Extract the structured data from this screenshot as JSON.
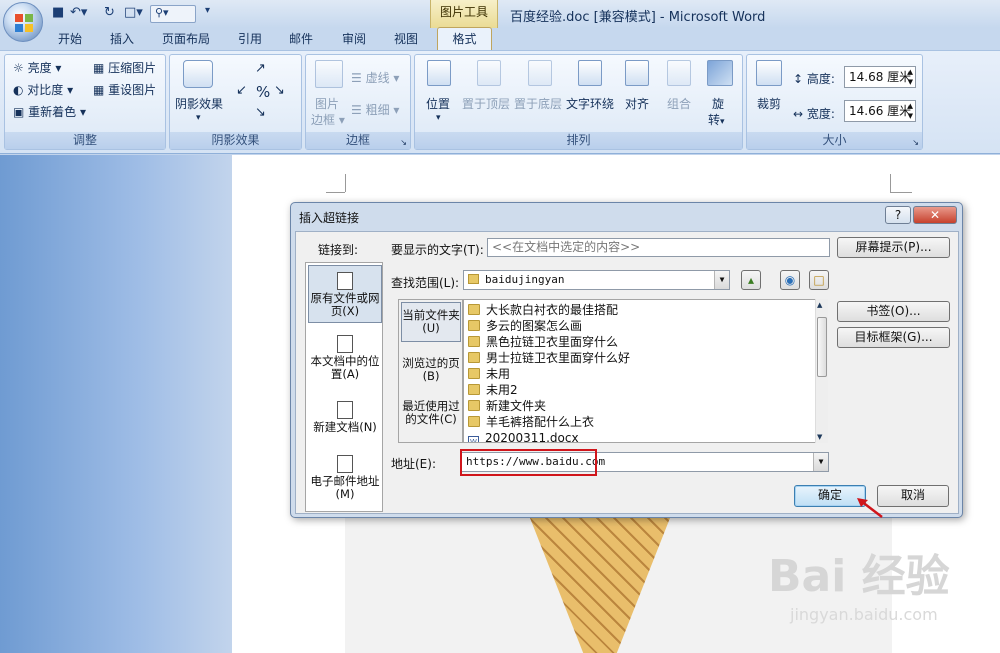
{
  "window": {
    "doc_title": "百度经验.doc [兼容模式] - Microsoft Word",
    "context_tab_group": "图片工具"
  },
  "tabs": [
    "开始",
    "插入",
    "页面布局",
    "引用",
    "邮件",
    "审阅",
    "视图",
    "格式"
  ],
  "active_tab": "格式",
  "ribbon": {
    "adjust": {
      "label": "调整",
      "brightness": "亮度",
      "contrast": "对比度",
      "recolor": "重新着色",
      "compress": "压缩图片",
      "reset": "重设图片"
    },
    "shadow": {
      "label": "阴影效果",
      "shadow_effects": "阴影效果"
    },
    "border": {
      "label": "边框",
      "picture_border_1": "图片",
      "picture_border_2": "边框",
      "dashes": "虚线",
      "weight": "粗细"
    },
    "arrange": {
      "label": "排列",
      "position": "位置",
      "bring_front": "置于顶层",
      "send_back": "置于底层",
      "text_wrap": "文字环绕",
      "align": "对齐",
      "group": "组合",
      "rotate_1": "旋",
      "rotate_2": "转"
    },
    "size": {
      "label": "大小",
      "crop": "裁剪",
      "height_label": "高度:",
      "height_value": "14.68 厘米",
      "width_label": "宽度:",
      "width_value": "14.66 厘米"
    }
  },
  "dialog": {
    "title": "插入超链接",
    "link_to_label": "链接到:",
    "link_to_items": [
      {
        "label": "原有文件或网页(X)"
      },
      {
        "label": "本文档中的位置(A)"
      },
      {
        "label": "新建文档(N)"
      },
      {
        "label": "电子邮件地址(M)"
      }
    ],
    "text_to_display_label": "要显示的文字(T):",
    "text_to_display_value": "<<在文档中选定的内容>>",
    "screen_tip_button": "屏幕提示(P)...",
    "look_in_label": "查找范围(L):",
    "look_in_value": "baidujingyan",
    "look_in_panel": [
      "当前文件夹(U)",
      "浏览过的页(B)",
      "最近使用过的文件(C)"
    ],
    "files": [
      {
        "name": "大长款白衬衣的最佳搭配",
        "type": "folder"
      },
      {
        "name": "多云的图案怎么画",
        "type": "folder"
      },
      {
        "name": "黑色拉链卫衣里面穿什么",
        "type": "folder"
      },
      {
        "name": "男士拉链卫衣里面穿什么好",
        "type": "folder"
      },
      {
        "name": "未用",
        "type": "folder"
      },
      {
        "name": "未用2",
        "type": "folder"
      },
      {
        "name": "新建文件夹",
        "type": "folder"
      },
      {
        "name": "羊毛裤搭配什么上衣",
        "type": "folder"
      },
      {
        "name": "20200311.docx",
        "type": "doc"
      }
    ],
    "bookmark_button": "书签(O)...",
    "target_frame_button": "目标框架(G)...",
    "address_label": "地址(E):",
    "address_value": "https://www.baidu.com",
    "ok_button": "确定",
    "cancel_button": "取消"
  },
  "watermark": {
    "logo": "Bai 经验",
    "url": "jingyan.baidu.com"
  }
}
